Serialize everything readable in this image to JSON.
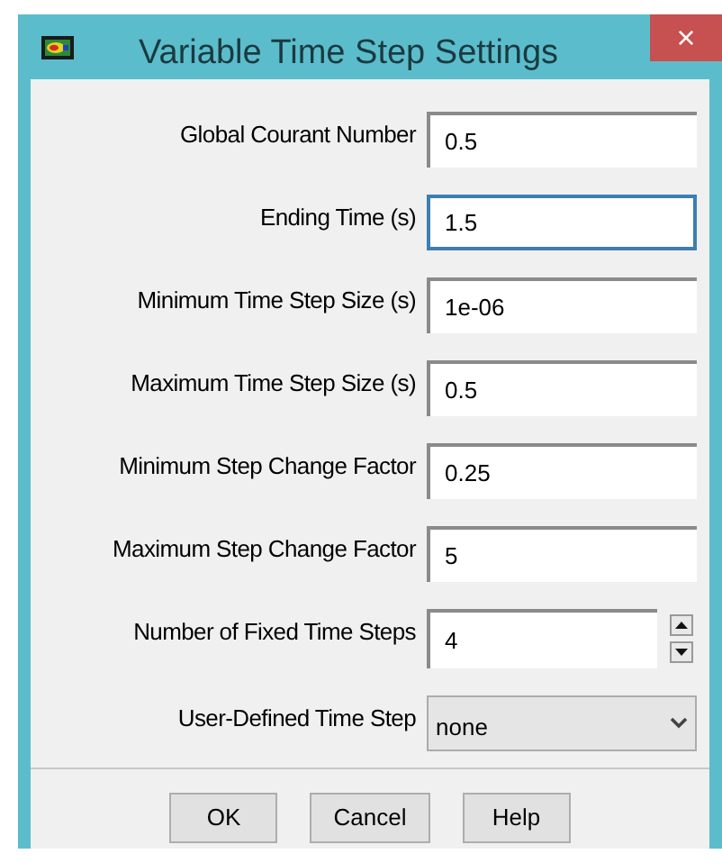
{
  "window": {
    "title": "Variable Time Step Settings",
    "close": "×"
  },
  "fields": [
    {
      "kind": "text",
      "label": "Global Courant Number",
      "value": "0.5",
      "focused": false
    },
    {
      "kind": "text",
      "label": "Ending Time (s)",
      "value": "1.5",
      "focused": true
    },
    {
      "kind": "text",
      "label": "Minimum Time Step Size (s)",
      "value": "1e-06",
      "focused": false
    },
    {
      "kind": "text",
      "label": "Maximum Time Step Size (s)",
      "value": "0.5",
      "focused": false
    },
    {
      "kind": "text",
      "label": "Minimum Step Change Factor",
      "value": "0.25",
      "focused": false
    },
    {
      "kind": "text",
      "label": "Maximum Step Change Factor",
      "value": "5",
      "focused": false
    },
    {
      "kind": "spin",
      "label": "Number of Fixed Time Steps",
      "value": "4",
      "focused": false
    },
    {
      "kind": "select",
      "label": "User-Defined Time Step",
      "value": "none",
      "focused": false
    }
  ],
  "buttons": [
    "OK",
    "Cancel",
    "Help"
  ]
}
